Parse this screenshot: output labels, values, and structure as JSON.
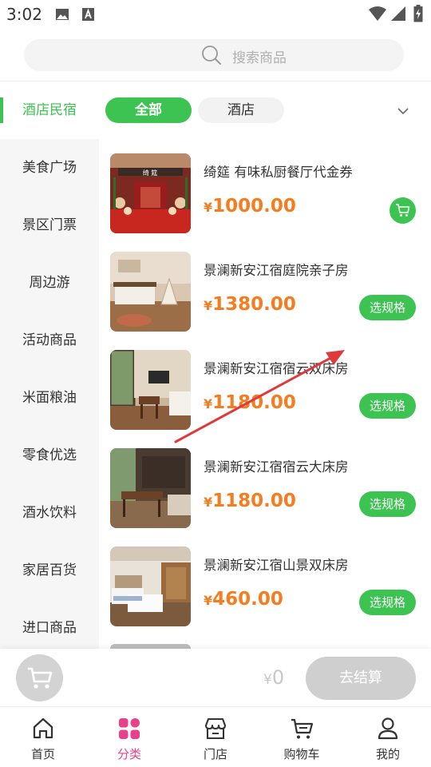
{
  "status_bar": {
    "time": "3:02",
    "icons": [
      "image-icon",
      "a-box-icon",
      "wifi-icon",
      "signal-icon",
      "battery-charging-icon"
    ]
  },
  "search": {
    "placeholder": "搜索商品"
  },
  "sidebar": {
    "items": [
      {
        "label": "酒店民宿",
        "active": true
      },
      {
        "label": "美食广场"
      },
      {
        "label": "景区门票"
      },
      {
        "label": "周边游"
      },
      {
        "label": "活动商品"
      },
      {
        "label": "米面粮油"
      },
      {
        "label": "零食优选"
      },
      {
        "label": "酒水饮料"
      },
      {
        "label": "家居百货"
      },
      {
        "label": "进口商品"
      }
    ]
  },
  "chips": {
    "all": "全部",
    "hotel": "酒店",
    "expand_icon": "chevron-down-icon"
  },
  "products": [
    {
      "title": "绮筵 有味私厨餐厅代金券",
      "currency": "¥",
      "price": "1000.00",
      "action": "cart",
      "image": "restaurant-photo"
    },
    {
      "title": "景澜新安江宿庭院亲子房",
      "currency": "¥",
      "price": "1380.00",
      "action_label": "选规格",
      "image": "family-room-photo"
    },
    {
      "title": "景澜新安江宿宿云双床房",
      "currency": "¥",
      "price": "1180.00",
      "action_label": "选规格",
      "image": "twin-room-photo"
    },
    {
      "title": "景澜新安江宿宿云大床房",
      "currency": "¥",
      "price": "1180.00",
      "action_label": "选规格",
      "image": "king-room-photo"
    },
    {
      "title": "景澜新安江宿山景双床房",
      "currency": "¥",
      "price": "460.00",
      "action_label": "选规格",
      "image": "mountain-view-room-photo"
    }
  ],
  "checkout": {
    "currency": "¥",
    "total": "0",
    "button_label": "去结算"
  },
  "bottom_nav": [
    {
      "label": "首页",
      "icon": "home-icon"
    },
    {
      "label": "分类",
      "icon": "grid-icon",
      "active": true
    },
    {
      "label": "门店",
      "icon": "store-icon"
    },
    {
      "label": "购物车",
      "icon": "cart-icon"
    },
    {
      "label": "我的",
      "icon": "user-icon"
    }
  ],
  "colors": {
    "accent": "#3cc351",
    "price": "#f57c1f",
    "nav_active": "#e8408a",
    "annotation_arrow": "#e0393b"
  }
}
